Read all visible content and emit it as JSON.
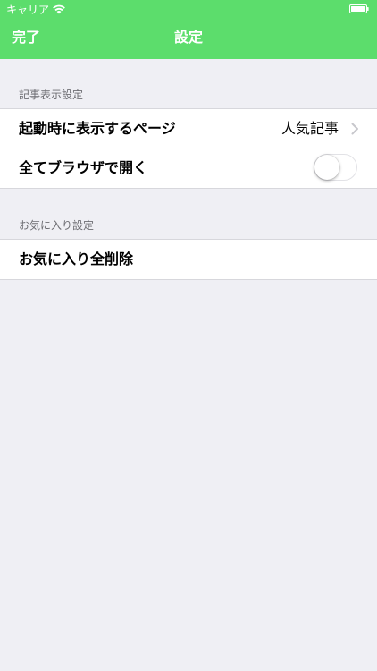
{
  "status_bar": {
    "carrier": "キャリア",
    "wifi_icon": "wifi-icon",
    "battery_icon": "battery-icon"
  },
  "nav": {
    "done_label": "完了",
    "title": "設定",
    "bar_color": "#5cdd6c"
  },
  "sections": {
    "article_display": {
      "header": "記事表示設定",
      "startup_page": {
        "label": "起動時に表示するページ",
        "value": "人気記事",
        "chevron_icon": "chevron-right-icon"
      },
      "open_in_browser": {
        "label": "全てブラウザで開く",
        "toggle_on": false
      }
    },
    "favorites": {
      "header": "お気に入り設定",
      "delete_all": {
        "label": "お気に入り全削除"
      }
    }
  }
}
